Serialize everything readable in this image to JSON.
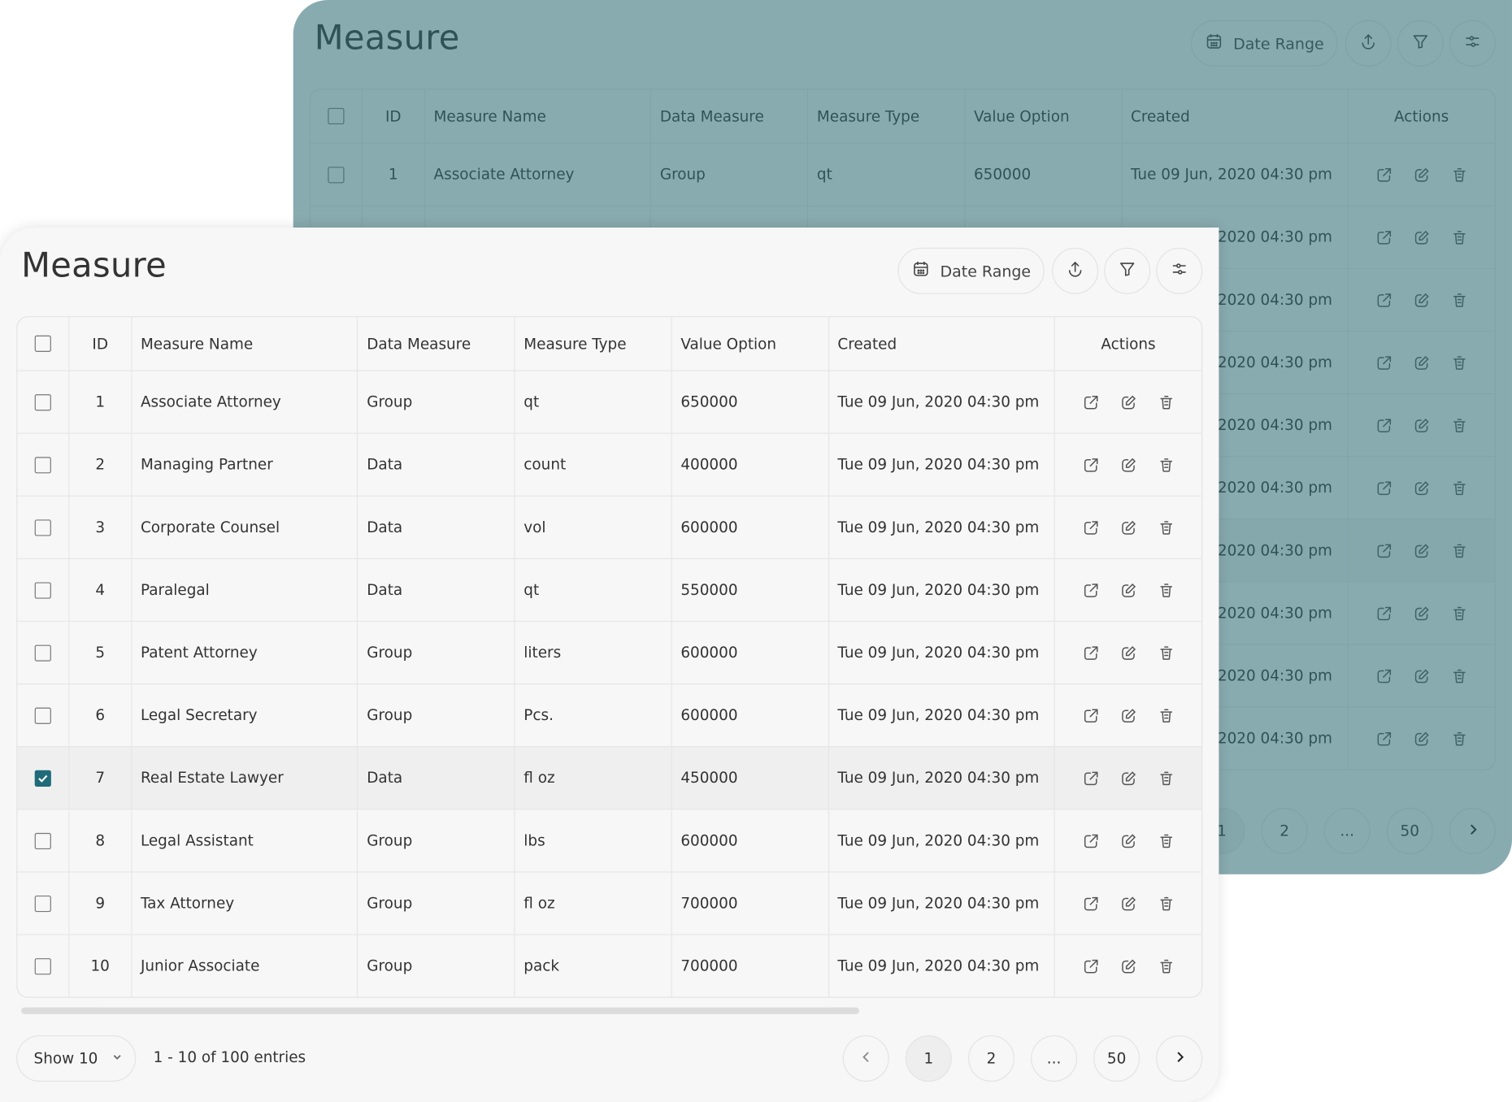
{
  "title": "Measure",
  "toolbar": {
    "date_range_label": "Date Range"
  },
  "columns": [
    "ID",
    "Measure Name",
    "Data Measure",
    "Measure Type",
    "Value Option",
    "Created",
    "Actions"
  ],
  "rows": [
    {
      "id": "1",
      "name": "Associate Attorney",
      "data_measure": "Group",
      "type": "qt",
      "value": "650000",
      "created": "Tue 09 Jun, 2020 04:30 pm",
      "checked": false
    },
    {
      "id": "2",
      "name": "Managing Partner",
      "data_measure": "Data",
      "type": "count",
      "value": "400000",
      "created": "Tue 09 Jun, 2020 04:30 pm",
      "checked": false
    },
    {
      "id": "3",
      "name": "Corporate Counsel",
      "data_measure": "Data",
      "type": "vol",
      "value": "600000",
      "created": "Tue 09 Jun, 2020 04:30 pm",
      "checked": false
    },
    {
      "id": "4",
      "name": "Paralegal",
      "data_measure": "Data",
      "type": "qt",
      "value": "550000",
      "created": "Tue 09 Jun, 2020 04:30 pm",
      "checked": false
    },
    {
      "id": "5",
      "name": "Patent Attorney",
      "data_measure": "Group",
      "type": "liters",
      "value": "600000",
      "created": "Tue 09 Jun, 2020 04:30 pm",
      "checked": false
    },
    {
      "id": "6",
      "name": "Legal Secretary",
      "data_measure": "Group",
      "type": "Pcs.",
      "value": "600000",
      "created": "Tue 09 Jun, 2020 04:30 pm",
      "checked": false
    },
    {
      "id": "7",
      "name": "Real Estate Lawyer",
      "data_measure": "Data",
      "type": "fl oz",
      "value": "450000",
      "created": "Tue 09 Jun, 2020 04:30 pm",
      "checked": true
    },
    {
      "id": "8",
      "name": "Legal Assistant",
      "data_measure": "Group",
      "type": "lbs",
      "value": "600000",
      "created": "Tue 09 Jun, 2020 04:30 pm",
      "checked": false
    },
    {
      "id": "9",
      "name": "Tax Attorney",
      "data_measure": "Group",
      "type": "fl oz",
      "value": "700000",
      "created": "Tue 09 Jun, 2020 04:30 pm",
      "checked": false
    },
    {
      "id": "10",
      "name": "Junior Associate",
      "data_measure": "Group",
      "type": "pack",
      "value": "700000",
      "created": "Tue 09 Jun, 2020 04:30 pm",
      "checked": false
    }
  ],
  "footer": {
    "show_label": "Show 10",
    "entries_label": "1 - 10 of 100 entries"
  },
  "pagination": {
    "pages": [
      "1",
      "2",
      "...",
      "50"
    ],
    "current": "1"
  },
  "colors": {
    "accent": "#1f6b7a",
    "panel_bg": "#f7f7f7",
    "back_overlay": "#88abb0"
  }
}
